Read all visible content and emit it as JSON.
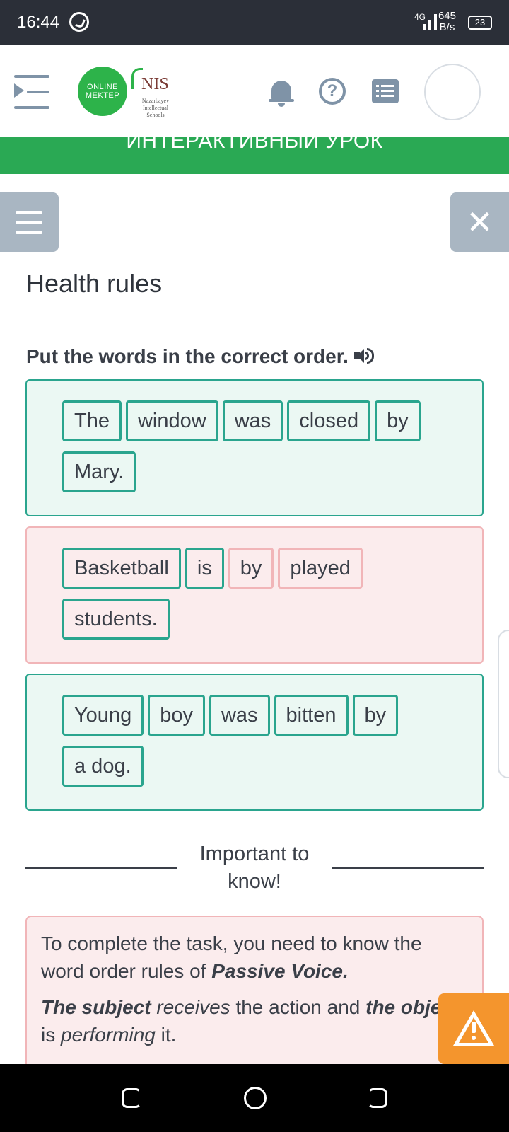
{
  "status_bar": {
    "time": "16:44",
    "network": "4G",
    "speed_value": "645",
    "speed_unit": "B/s",
    "battery": "23"
  },
  "header": {
    "logo_online_mektep_line1": "ONLINE",
    "logo_online_mektep_line2": "MEKTEP",
    "logo_nis": "NIS",
    "logo_nis_sub": "Nazarbayev Intellectual Schools",
    "help_glyph": "?"
  },
  "banner": {
    "text": "ИНТЕРАКТИВНЫЙ УРОК"
  },
  "lesson": {
    "title": "Health rules",
    "instruction": "Put the words in the correct order.",
    "close_glyph": "✕"
  },
  "exercises": [
    {
      "status": "correct",
      "words": [
        {
          "text": "The",
          "state": "correct"
        },
        {
          "text": "window",
          "state": "correct"
        },
        {
          "text": "was",
          "state": "correct"
        },
        {
          "text": "closed",
          "state": "correct"
        },
        {
          "text": "by",
          "state": "correct"
        },
        {
          "text": "Mary.",
          "state": "correct"
        }
      ]
    },
    {
      "status": "incorrect",
      "words": [
        {
          "text": "Basketball",
          "state": "correct"
        },
        {
          "text": "is",
          "state": "correct"
        },
        {
          "text": "by",
          "state": "incorrect"
        },
        {
          "text": "played",
          "state": "incorrect"
        },
        {
          "text": "students.",
          "state": "correct"
        }
      ]
    },
    {
      "status": "correct",
      "words": [
        {
          "text": "Young",
          "state": "correct"
        },
        {
          "text": "boy",
          "state": "correct"
        },
        {
          "text": "was",
          "state": "correct"
        },
        {
          "text": "bitten",
          "state": "correct"
        },
        {
          "text": "by",
          "state": "correct"
        },
        {
          "text": "a dog.",
          "state": "correct"
        }
      ]
    }
  ],
  "important": {
    "heading": "Important to know!",
    "p1_plain": "To complete the task, you need to know the word order rules of ",
    "p1_bold": "Passive Voice.",
    "p2_subject": "The subject",
    "p2_receives": "receives",
    "p2_mid": " the action and ",
    "p2_object": "the object",
    "p2_is": " is ",
    "p2_performing": "performing",
    "p2_end": " it."
  },
  "colors": {
    "accent_green": "#2aa954",
    "correct_border": "#2aa58e",
    "correct_bg": "#ebf8f3",
    "incorrect_border": "#f1b5b8",
    "incorrect_bg": "#fbeced",
    "warning": "#f4952d",
    "icon_gray": "#7f93a7"
  }
}
